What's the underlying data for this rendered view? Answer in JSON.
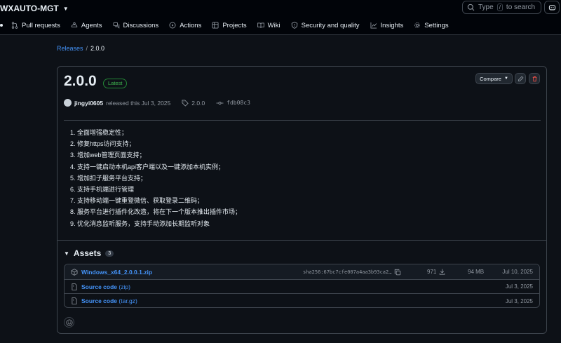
{
  "header": {
    "repo_name": "WXAUTO-MGT",
    "search_prefix": "Type",
    "search_key": "/",
    "search_suffix": "to search"
  },
  "nav": {
    "items": [
      {
        "label": "Pull requests",
        "icon": "pull-request-icon"
      },
      {
        "label": "Agents",
        "icon": "agents-icon"
      },
      {
        "label": "Discussions",
        "icon": "discussions-icon"
      },
      {
        "label": "Actions",
        "icon": "actions-icon"
      },
      {
        "label": "Projects",
        "icon": "projects-icon"
      },
      {
        "label": "Wiki",
        "icon": "wiki-icon"
      },
      {
        "label": "Security and quality",
        "icon": "shield-icon"
      },
      {
        "label": "Insights",
        "icon": "graph-icon"
      },
      {
        "label": "Settings",
        "icon": "gear-icon"
      }
    ]
  },
  "breadcrumb": {
    "releases": "Releases",
    "separator": "/",
    "current": "2.0.0"
  },
  "release": {
    "title": "2.0.0",
    "badge": "Latest",
    "compare_label": "Compare",
    "author": "jingyi0605",
    "released_text": "released this Jul 3, 2025",
    "tag": "2.0.0",
    "commit": "fdb08c3",
    "notes": [
      "1. 全面增强稳定性；",
      "2. 修复https访问支持；",
      "3. 增加web管理页面支持；",
      "4. 支持一键启动本机api客户端以及一键添加本机实例；",
      "5. 增加扣子服务平台支持；",
      "6. 支持手机端进行管理",
      "7. 支持移动端一键重登微信、获取登录二维码；",
      "8. 服务平台进行插件化改造，将在下一个版本推出插件市场；",
      "9. 优化消息监听服务，支持手动添加长期监听对象"
    ]
  },
  "assets": {
    "title": "Assets",
    "count": "3",
    "rows": [
      {
        "name": "Windows_x64_2.0.0.1.zip",
        "suffix": "",
        "sha": "sha256:67bc7cfe007a4aa3b93ca2…",
        "downloads": "971",
        "size": "94 MB",
        "date": "Jul 10, 2025"
      },
      {
        "name": "Source code",
        "suffix": "(zip)",
        "sha": "",
        "downloads": "",
        "size": "",
        "date": "Jul 3, 2025"
      },
      {
        "name": "Source code",
        "suffix": "(tar.gz)",
        "sha": "",
        "downloads": "",
        "size": "",
        "date": "Jul 3, 2025"
      }
    ]
  },
  "colors": {
    "background": "#0d1117",
    "link": "#4493f8",
    "latest": "#3fb950",
    "delete": "#f85149"
  }
}
